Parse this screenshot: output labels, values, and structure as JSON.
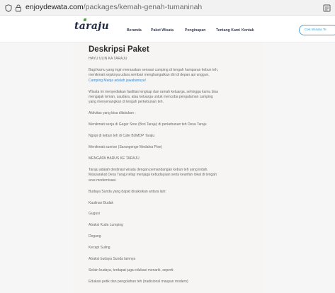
{
  "browser": {
    "url_domain": "enjoydewata.com",
    "url_path": "/packages/kemah-genah-tumaninah"
  },
  "site": {
    "logo": "taraju",
    "nav": [
      "Beranda",
      "Paket Wisata",
      "Penginapan",
      "Tentang Kami",
      "Kontak"
    ],
    "cta": "Cek Wisata Te"
  },
  "content": {
    "title": "Deskripsi Paket",
    "subtitle": "HAYU ULIN KA TARAJU",
    "para1": [
      "Bagi kamu yang ingin merasakan sensasi camping di tengah hamparan kebun teh,",
      "menikmati sejuknya udara sembari menghangatkan diri di depan api unggun,"
    ],
    "para1_highlight": "Camping Manja adalah jawabannya!",
    "para2": [
      "Wisata ini menyediakan fasilitas lengkap dan ramah keluarga, sehingga kamu bisa",
      "mengajak teman, saudara, atau keluarga untuk mencoba pengalaman camping",
      "yang menyenangkan di tengah perkebunan teh."
    ],
    "items1": [
      "Aktivitas yang bisa dilakukan :",
      "Menikmati senja di Geger Sore (Bori Taraju) di perkebunan teh Desa Taraju",
      "Ngopi di kebun teh di Cafe BUMDP Taraju",
      "Menikmati sunrise (Sarangenge Medalna Pise)",
      "MENGAPA HARUS KE TARAJU"
    ],
    "para3": [
      "Taraju adalah destinasi wisata dengan pemandangan kebun teh yang indah.",
      "Masyarakat Desa Taraju tetap menjaga kebudayaan serta kearifan lokal di tengah",
      "arus modernisasi."
    ],
    "items2": [
      "Budaya Sunda yang dapat disaksikan antara lain:",
      "Kaulinan Budak",
      "Gugusi",
      "Atraksi Kuda Lumping",
      "Degung",
      "Kecapi Suling",
      "Atraksi budaya Sunda lainnya",
      "Selain budaya, terdapat juga edukasi menarik, seperti:",
      "Edukasi petik dan pengolahan teh (tradisional maupun modern)"
    ]
  },
  "colors": {
    "link": "#3a86c6",
    "cta_border": "#4aa0d8",
    "logo": "#1f2a44"
  }
}
